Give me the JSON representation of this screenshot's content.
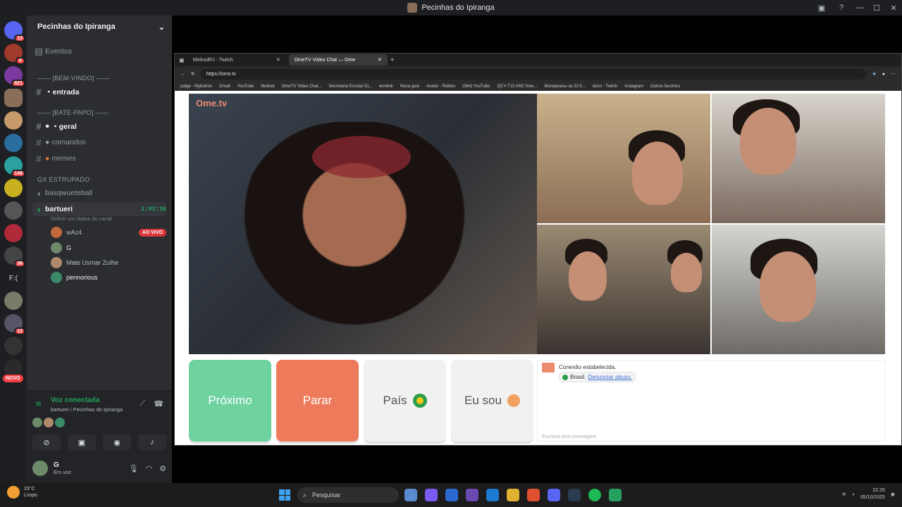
{
  "window": {
    "title": "Pecinhas do Ipiranga"
  },
  "server": {
    "name": "Pecinhas do Ipiranga",
    "badges": [
      "13",
      "8",
      "821",
      "148",
      "36",
      "12"
    ],
    "novo": "NOVO",
    "text_server_label": "F:("
  },
  "channels": {
    "events": "Eventos",
    "cat_welcome": "—— [BEM-VINDO] ——",
    "entrada": "・entrada",
    "cat_chat": "—— [BATE-PAPO] ——",
    "geral": "・geral",
    "comandos": "comandos",
    "memes": "memes",
    "cat_gx": "GX ESTRUPADO",
    "basq": "basqwueteball",
    "bartueri": "bartueri",
    "bartueri_time": "1:02:36",
    "status_hint": "Definir um status do canal",
    "voice_users": [
      {
        "name": "wAz4",
        "live": "AO VIVO"
      },
      {
        "name": "G"
      },
      {
        "name": "Mate Usmar Zulhe"
      },
      {
        "name": "pennorious"
      }
    ]
  },
  "voice": {
    "connected": "Voz conectada",
    "where": "bartueri / Pecinhas do Ipiranga"
  },
  "user": {
    "name": "G",
    "status": "Em voz"
  },
  "browser": {
    "tabs": [
      {
        "label": "MeikodRJ - Twitch"
      },
      {
        "label": "OmeTV Video Chat — Ome"
      }
    ],
    "url": "https://ome.tv",
    "bookmarks": [
      "judge - Mybotrun",
      "Gmail",
      "YouTube",
      "Meikod",
      "OmeTV Video Chat...",
      "Secretaria Escolar Di...",
      "wonlink",
      "Nova guia",
      "Avatar - Roblox",
      "(584) YouTube",
      "QCY-T13 ANC fone...",
      "Материалы за 22.0...",
      "dono - Twitch",
      "Instagram",
      "Outros favoritos"
    ]
  },
  "ometv": {
    "logo": "Ome.tv",
    "next": "Próximo",
    "stop": "Parar",
    "country": "País",
    "iam": "Eu sou",
    "chat_status": "Conexão estabelecida.",
    "chat_country": "Brasil.",
    "chat_report": "Denunciar abuso.",
    "chat_placeholder": "Escreva uma mensagem"
  },
  "taskbar": {
    "temp": "23°C",
    "weather": "Limpo",
    "search": "Pesquisar",
    "time": "22:25",
    "date": "05/10/2025"
  },
  "colors": {
    "next": "#6fd3a0",
    "stop": "#ed7a5b",
    "live": "#da373c",
    "connected": "#23a55a"
  }
}
